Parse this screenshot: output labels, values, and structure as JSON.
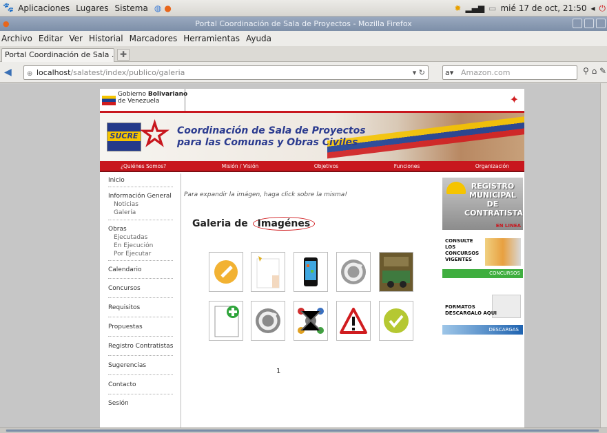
{
  "top_panel": {
    "menus": [
      "Aplicaciones",
      "Lugares",
      "Sistema"
    ],
    "clock": "mié 17 de oct, 21:50"
  },
  "window": {
    "title": "Portal Coordinación de Sala de Proyectos - Mozilla Firefox"
  },
  "menubar": [
    "Archivo",
    "Editar",
    "Ver",
    "Historial",
    "Marcadores",
    "Herramientas",
    "Ayuda"
  ],
  "tab": {
    "label": "Portal Coordinación de Sala ..."
  },
  "url": {
    "host": "localhost",
    "path": "/salatest/index/publico/galeria"
  },
  "search": {
    "placeholder": "Amazon.com"
  },
  "site": {
    "gov_line1": "Gobierno",
    "gov_bold": "Bolivariano",
    "gov_line2": "de Venezuela",
    "banner_title_line1": "Coordinación de Sala de Proyectos",
    "banner_title_line2": "para las Comunas y Obras Civiles",
    "logo_text": "SUCRE",
    "nav": [
      "¿Quiénes Somos?",
      "Misión / Visión",
      "Objetivos",
      "Funciones",
      "Organización"
    ],
    "left_menu": {
      "inicio": "Inicio",
      "info_general": "Información General",
      "noticias": "Noticias",
      "galeria": "Galería",
      "obras": "Obras",
      "ejecutadas": "Ejecutadas",
      "en_ejecucion": "En Ejecución",
      "por_ejecutar": "Por Ejecutar",
      "calendario": "Calendario",
      "concursos": "Concursos",
      "requisitos": "Requisitos",
      "propuestas": "Propuestas",
      "registro": "Registro Contratistas",
      "sugerencias": "Sugerencias",
      "contacto": "Contacto",
      "sesion": "Sesión"
    },
    "hint": "Para expandir la imágen, haga click sobre la misma!",
    "gallery_title_a": "Galeria de",
    "gallery_title_b": "Imagénes",
    "pager": "1",
    "right": {
      "registro": "REGISTRO MUNICIPAL DE CONTRATISTAS",
      "en_linea": "EN LINEA",
      "consulte": "CONSULTE LOS CONCURSOS VIGENTES",
      "concursos_btn": "CONCURSOS",
      "formatos": "FORMATOS DESCARGALO AQUI",
      "descargas_btn": "DESCARGAS"
    }
  },
  "gallery_icons": [
    "pencil-icon",
    "blank-page-icon",
    "phone-icon",
    "refresh-icon",
    "photo-icon",
    "add-document-icon",
    "refresh-icon",
    "network-icon",
    "warning-icon",
    "check-icon"
  ],
  "colors": {
    "site_red": "#c8171e",
    "site_blue": "#2b3b8f",
    "panel_bg": "#dcdad5"
  }
}
